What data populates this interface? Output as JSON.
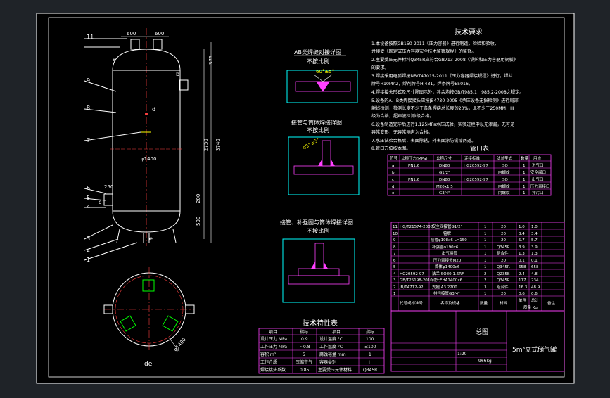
{
  "drawing": {
    "title_main": "技术要求",
    "tech_notes": [
      "1.本设备按照GB150-2011《压力容器》进行制造，检验和验收，",
      "   并接受《固定式压力容器安全技术监察规程》的监督。",
      "2.主要受压元件材料Q345R应符合GB713-2008《锅炉和压力容器用钢板》",
      "   的要求。",
      "3.焊接采用电弧焊按NB/T47015-2011《压力容器焊接规程》进行，焊丝",
      "   牌号H10Mn2，焊剂牌号HJ431，焊条牌号E5016。",
      "4.焊接接头形式及尺寸除图示外，其余均按GB/T985.1，985.2-2008之规定。",
      "5.设备的A、B类焊接接头应按JB4730-2005《承压设备无损检测》进行局部",
      "   射线检测，检测长度不少于各条焊缝总长度的20%，且不少于250MM，III",
      "   级为合格，超声波检测I级合格。",
      "6.设备制造完毕后进行1.125MPa水压试验，实验过程中以无渗漏，无可见",
      "   异常变形，无异常响声为合格。",
      "7.水压试验合格后，表面除锈，外表面涂防锈漆两道。",
      "8.管口方位按本图。"
    ],
    "weld_details": {
      "d1_title": "AB类焊缝对接详图",
      "d1_sub": "不按比例",
      "d1_angle": "60°±5°",
      "d2_title": "接管与筒体焊接详图",
      "d2_sub": "不按比例",
      "d2_angle": "45°±5°",
      "d3_title": "接管、补强圈与筒体焊接详图",
      "d3_sub": "不按比例"
    },
    "nozzle_table": {
      "title": "管口表",
      "headers": [
        "符号",
        "公称压力(MPa)",
        "公称尺寸",
        "连接标准",
        "法兰型式",
        "数量",
        "用途"
      ],
      "rows": [
        [
          "a",
          "PN1.6",
          "DN80",
          "HG20592-97",
          "SO",
          "1",
          "进气口"
        ],
        [
          "b",
          "",
          "G1/2\"",
          "",
          "内螺纹",
          "1",
          "安全阀口"
        ],
        [
          "c",
          "PN1.6",
          "DN80",
          "HG20592-97",
          "SO",
          "1",
          "出气口"
        ],
        [
          "d",
          "",
          "M20x1.5",
          "",
          "内螺纹",
          "1",
          "压力表接口"
        ],
        [
          "e",
          "",
          "G3/4\"",
          "",
          "内螺纹",
          "1",
          "排污口"
        ]
      ]
    },
    "parts_list": {
      "rows": [
        [
          "11",
          "HG/T21574-2008",
          "安全阀接管G1/2\"",
          "1",
          "20",
          "1.0",
          "1.0"
        ],
        [
          "10",
          "",
          "铭牌",
          "1",
          "20",
          "3.4",
          "3.4"
        ],
        [
          "9",
          "",
          "接管φ108x6 L=150",
          "1",
          "20",
          "5.7",
          "5.7"
        ],
        [
          "8",
          "",
          "补强圈φ190x6",
          "1",
          "Q345R",
          "3.9",
          "3.9"
        ],
        [
          "7",
          "",
          "出气接管",
          "1",
          "组合件",
          "1.3",
          "1.3"
        ],
        [
          "6",
          "",
          "压力表接头M20",
          "1",
          "20",
          "0.1",
          "0.1"
        ],
        [
          "5",
          "",
          "筒体φ1400x6",
          "1",
          "Q345R",
          "658",
          "658"
        ],
        [
          "4",
          "HG20592-97",
          "法兰 SO80-1.6RF",
          "2",
          "Q235B",
          "2.4",
          "4.8"
        ],
        [
          "3",
          "GB/T25198-2010",
          "封头EHA1400x6",
          "2",
          "Q345R",
          "117",
          "234"
        ],
        [
          "2",
          "JB/T4712-92",
          "支腿 A3 2200",
          "3",
          "组合件",
          "16.3",
          "48.9"
        ],
        [
          "1",
          "",
          "排污接管G3/4\"",
          "1",
          "20",
          "0.6",
          "0.6"
        ]
      ],
      "header_code": "代号或标准号",
      "header_name": "名称及规格",
      "header_qty": "数量",
      "header_mat": "材料",
      "header_unit": "单件",
      "header_total": "总计",
      "header_weight": "质量 Kg",
      "header_note": "备注"
    },
    "spec_table": {
      "title": "技术特性表",
      "headers": [
        "项目",
        "指标",
        "项目",
        "指标"
      ],
      "rows": [
        [
          "设计压力 MPa",
          "0.9",
          "设计温度 °C",
          "100"
        ],
        [
          "工作压力 MPa",
          "~0.8",
          "工作温度 °C",
          "≤100"
        ],
        [
          "容积 m³",
          "5",
          "腐蚀裕量 mm",
          "1"
        ],
        [
          "工作介质",
          "压缩空气",
          "容器类别",
          "I"
        ],
        [
          "焊接接头系数",
          "0.85",
          "主要受压元件材料",
          "Q345R"
        ]
      ]
    },
    "title_block": {
      "drawing_name": "总图",
      "product_name": "5m³立式储气罐",
      "mass": "966kg",
      "scale": "1:20"
    },
    "elevation": {
      "labels": [
        "11",
        "9",
        "8",
        "7",
        "6",
        "5",
        "4",
        "3",
        "2",
        "1",
        "a",
        "b",
        "c",
        "d",
        "e"
      ],
      "dims": [
        "600",
        "600",
        "375",
        "2750",
        "3740",
        "φ1400",
        "250",
        "200",
        "500"
      ]
    },
    "plan_view": {
      "label": "de",
      "diameter": "φ1400"
    }
  }
}
